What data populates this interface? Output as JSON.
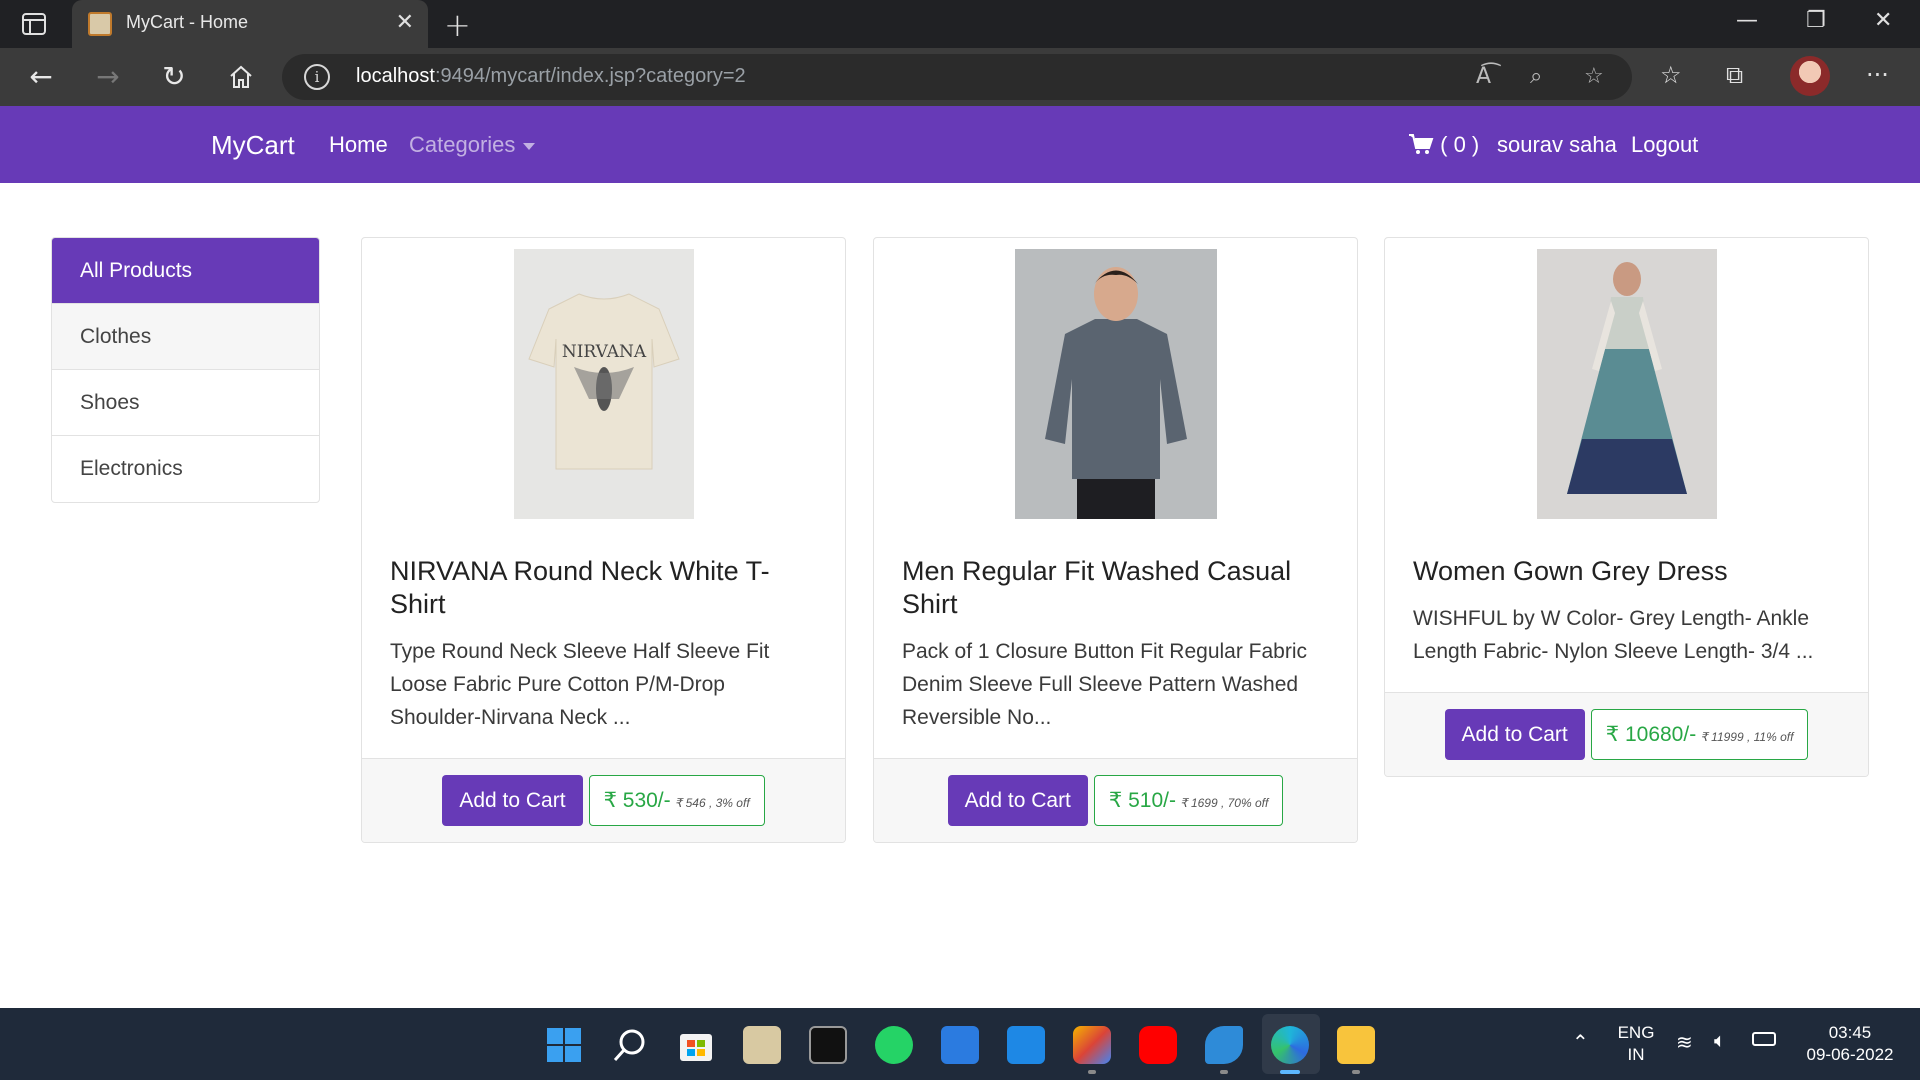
{
  "browser": {
    "tab_title": "MyCart - Home",
    "url_host": "localhost",
    "url_rest": ":9494/mycart/index.jsp?category=2"
  },
  "navbar": {
    "brand": "MyCart",
    "home": "Home",
    "categories": "Categories",
    "cart": "( 0 )",
    "user": "sourav saha",
    "logout": "Logout"
  },
  "sidebar": {
    "items": [
      {
        "label": "All Products"
      },
      {
        "label": "Clothes"
      },
      {
        "label": "Shoes"
      },
      {
        "label": "Electronics"
      }
    ]
  },
  "products": [
    {
      "title": "NIRVANA Round Neck White T-Shirt",
      "description": "Type Round Neck Sleeve Half Sleeve Fit Loose Fabric Pure Cotton P/M-Drop Shoulder-Nirvana Neck ...",
      "button": "Add to Cart",
      "price": "₹ 530/-",
      "original": "₹ 546 , 3% off",
      "image_text": "NIRVANA"
    },
    {
      "title": "Men Regular Fit Washed Casual Shirt",
      "description": "Pack of 1 Closure Button Fit Regular Fabric Denim Sleeve Full Sleeve Pattern Washed Reversible No...",
      "button": "Add to Cart",
      "price": "₹ 510/-",
      "original": "₹ 1699 , 70% off"
    },
    {
      "title": "Women Gown Grey Dress",
      "description": "WISHFUL by W Color- Grey Length- Ankle Length Fabric- Nylon Sleeve Length- 3/4 ...",
      "button": "Add to Cart",
      "price": "₹ 10680/-",
      "original": "₹ 11999 , 11% off"
    }
  ],
  "taskbar": {
    "lang_line1": "ENG",
    "lang_line2": "IN",
    "time": "03:45",
    "date": "09-06-2022"
  },
  "colors": {
    "primary": "#673ab7",
    "success": "#28a745"
  }
}
